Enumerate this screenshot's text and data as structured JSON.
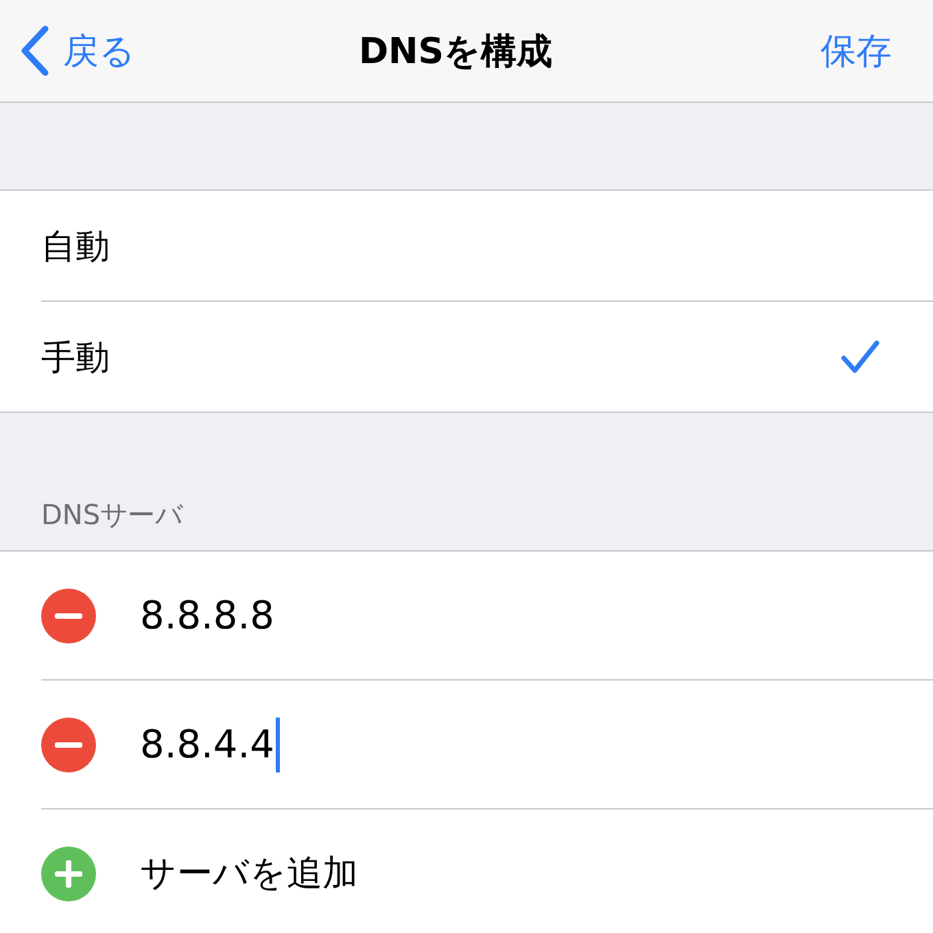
{
  "nav": {
    "back": "戻る",
    "title": "DNSを構成",
    "save": "保存"
  },
  "modes": [
    {
      "label": "自動",
      "selected": false
    },
    {
      "label": "手動",
      "selected": true
    }
  ],
  "dns_header": "DNSサーバ",
  "servers": [
    {
      "kind": "entry",
      "value": "8.8.8.8",
      "focused": false
    },
    {
      "kind": "entry",
      "value": "8.8.4.4",
      "focused": true
    },
    {
      "kind": "add",
      "label": "サーバを追加"
    }
  ]
}
